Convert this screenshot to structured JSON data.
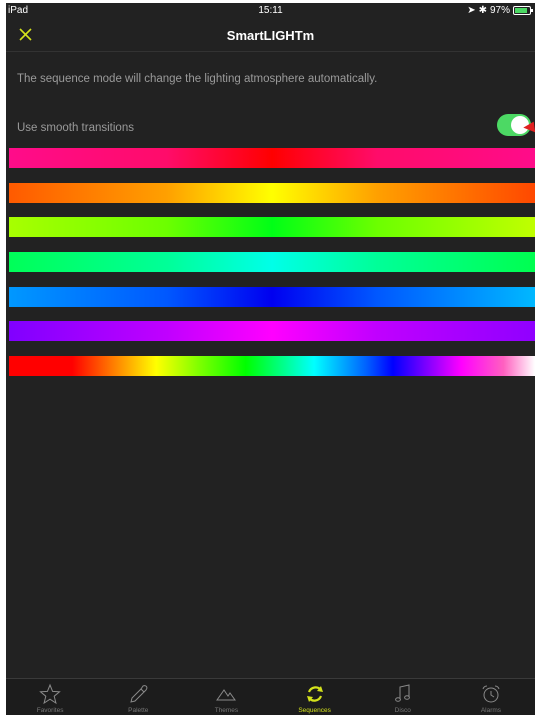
{
  "status_bar": {
    "device": "iPad",
    "time": "15:11",
    "battery": "97%"
  },
  "navbar": {
    "title": "SmartLIGHTm"
  },
  "description": "The sequence mode will change the lighting atmosphere automatically.",
  "smooth_transitions": {
    "label": "Use smooth transitions",
    "enabled": true
  },
  "sequences": [
    {
      "name": "pink-red"
    },
    {
      "name": "orange-yellow"
    },
    {
      "name": "lime-green"
    },
    {
      "name": "green-cyan"
    },
    {
      "name": "sky-blue"
    },
    {
      "name": "purple-magenta"
    },
    {
      "name": "rainbow"
    }
  ],
  "tabs": [
    {
      "label": "Favorites",
      "icon": "star-icon"
    },
    {
      "label": "Palette",
      "icon": "pipette-icon"
    },
    {
      "label": "Themes",
      "icon": "mountain-icon"
    },
    {
      "label": "Sequences",
      "icon": "cycle-icon",
      "active": true
    },
    {
      "label": "Disco",
      "icon": "music-note-icon"
    },
    {
      "label": "Alarms",
      "icon": "alarm-clock-icon"
    }
  ],
  "colors": {
    "accent": "#d4e21c",
    "toggle_on": "#4cd964",
    "background": "#222222"
  }
}
